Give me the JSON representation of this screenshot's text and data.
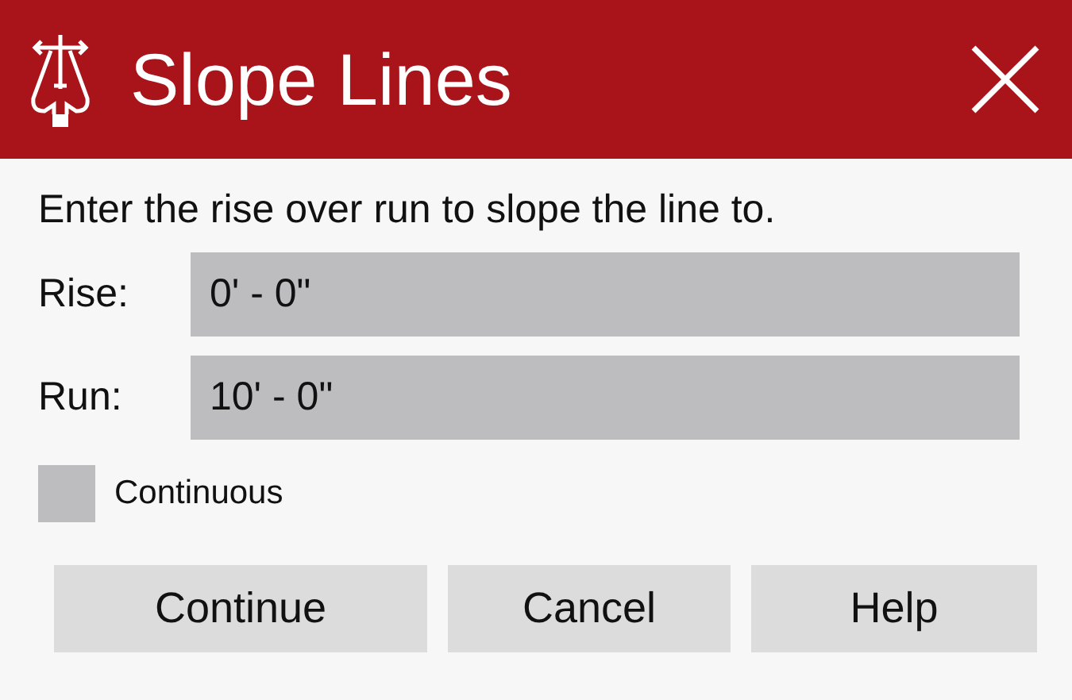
{
  "window": {
    "title": "Slope Lines"
  },
  "instruction": "Enter the rise over run to slope the line to.",
  "fields": [
    {
      "label": "Rise:",
      "value": "0' - 0\""
    },
    {
      "label": "Run:",
      "value": "10' - 0\""
    }
  ],
  "continuous": {
    "label": "Continuous",
    "checked": false
  },
  "buttons": [
    "Continue",
    "Cancel",
    "Help"
  ]
}
